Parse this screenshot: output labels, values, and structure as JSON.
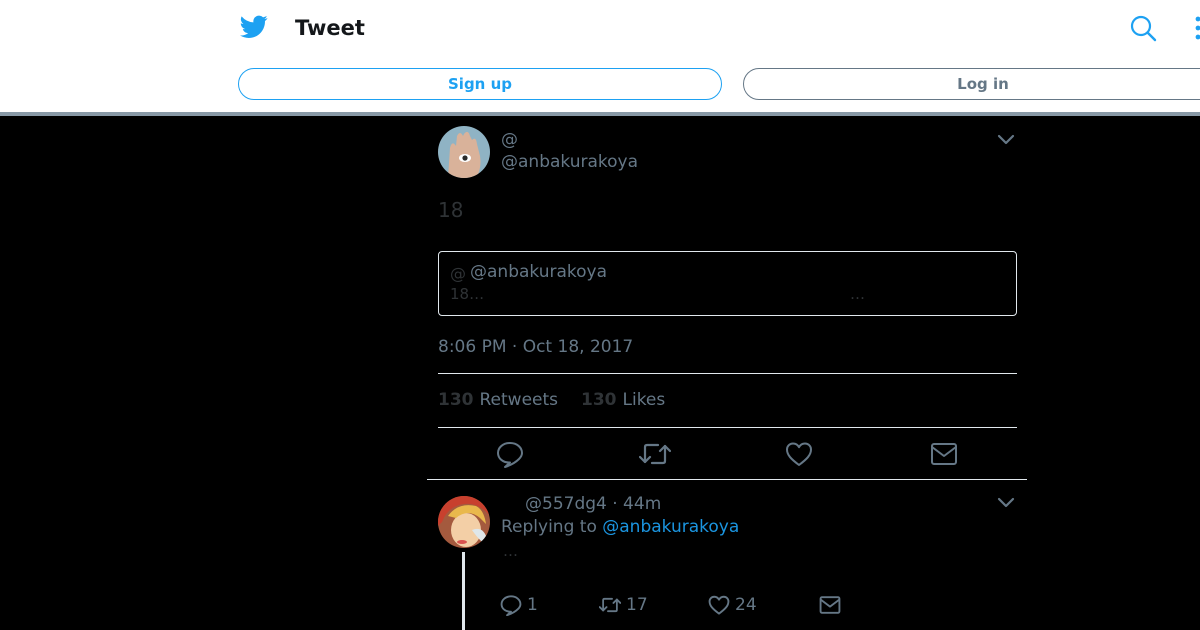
{
  "header": {
    "title": "Tweet",
    "signup_label": "Sign up",
    "login_label": "Log in"
  },
  "tweet": {
    "display_name": "@",
    "username": "@anbakurakoya",
    "text": "18",
    "quote": {
      "display_name": "@",
      "username": "@anbakurakoya",
      "text": "18…",
      "trailing": "…"
    },
    "timestamp": "8:06 PM · Oct 18, 2017",
    "retweets_count": "130",
    "retweets_label": "Retweets",
    "likes_count": "130",
    "likes_label": "Likes"
  },
  "reply": {
    "meta": "@557dg4 · 44m",
    "replying_prefix": "Replying to",
    "replying_to": "@anbakurakoya",
    "text": "…",
    "reply_count": "1",
    "retweet_count": "17",
    "like_count": "24"
  },
  "colors": {
    "brand_blue": "#1da1f2",
    "link_blue": "#1b95e0",
    "secondary_grey": "#657786",
    "background": "#000000"
  }
}
